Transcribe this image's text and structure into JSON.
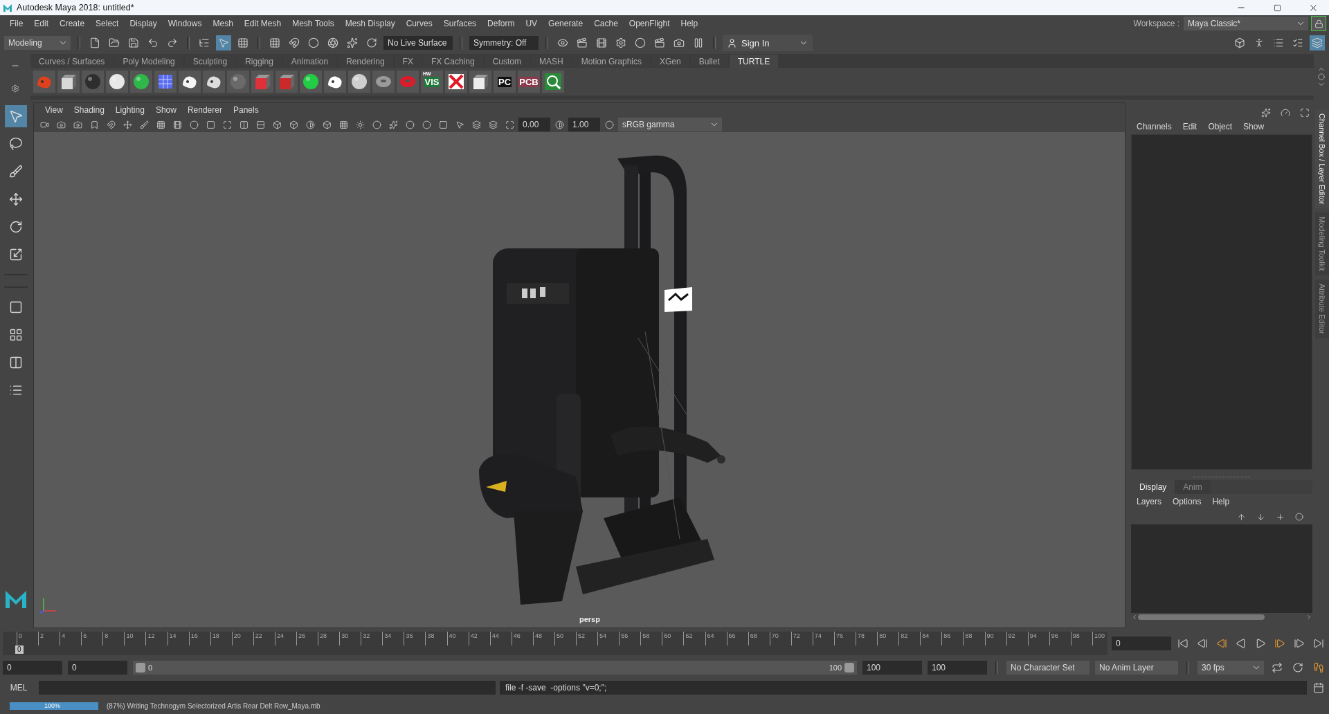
{
  "window": {
    "title": "Autodesk Maya 2018: untitled*"
  },
  "menu_bar": [
    "File",
    "Edit",
    "Create",
    "Select",
    "Display",
    "Windows",
    "Mesh",
    "Edit Mesh",
    "Mesh Tools",
    "Mesh Display",
    "Curves",
    "Surfaces",
    "Deform",
    "UV",
    "Generate",
    "Cache",
    "OpenFlight",
    "Help"
  ],
  "workspace": {
    "label": "Workspace :",
    "value": "Maya Classic*"
  },
  "status_line": {
    "menu_set": "Modeling",
    "live_surface": "No Live Surface",
    "symmetry": "Symmetry: Off",
    "sign_in": "Sign In"
  },
  "shelf_tabs": [
    {
      "label": "Curves / Surfaces",
      "selected": false
    },
    {
      "label": "Poly Modeling",
      "selected": false
    },
    {
      "label": "Sculpting",
      "selected": false
    },
    {
      "label": "Rigging",
      "selected": false
    },
    {
      "label": "Animation",
      "selected": false
    },
    {
      "label": "Rendering",
      "selected": false
    },
    {
      "label": "FX",
      "selected": false
    },
    {
      "label": "FX Caching",
      "selected": false
    },
    {
      "label": "Custom",
      "selected": false
    },
    {
      "label": "MASH",
      "selected": false
    },
    {
      "label": "Motion Graphics",
      "selected": false
    },
    {
      "label": "XGen",
      "selected": false
    },
    {
      "label": "Bullet",
      "selected": false
    },
    {
      "label": "TURTLE",
      "selected": true
    }
  ],
  "shelf_icons": [
    {
      "kind": "blob",
      "color": "#e0401c"
    },
    {
      "kind": "cube",
      "color": "#d8d8d8"
    },
    {
      "kind": "sphere",
      "color": "#2e2e2e"
    },
    {
      "kind": "sphere",
      "color": "#e8e8e8"
    },
    {
      "kind": "sphere",
      "color": "#2fb84a"
    },
    {
      "kind": "grid",
      "color": "#5a6cf0"
    },
    {
      "kind": "blob",
      "color": "#f4f4f4"
    },
    {
      "kind": "blob",
      "color": "#dddddd"
    },
    {
      "kind": "sphere",
      "color": "#6a6a6a"
    },
    {
      "kind": "cube",
      "color": "#e0303a"
    },
    {
      "kind": "cube",
      "color": "#cc2a2a"
    },
    {
      "kind": "sphere",
      "color": "#22cc44"
    },
    {
      "kind": "blob",
      "color": "#ffffff"
    },
    {
      "kind": "sphere",
      "color": "#cfcfcf"
    },
    {
      "kind": "torus",
      "color": "#9a9a9a"
    },
    {
      "kind": "torus",
      "color": "#e01a28"
    },
    {
      "kind": "label",
      "color": "#1f7a3a",
      "sublabel": "HW",
      "label": "VIS"
    },
    {
      "kind": "cross",
      "color": "#e01a28"
    },
    {
      "kind": "cube",
      "color": "#eeeeee"
    },
    {
      "kind": "label",
      "color": "#111111",
      "label": "PC"
    },
    {
      "kind": "label",
      "color": "#8a3a4a",
      "label": "PCB"
    },
    {
      "kind": "magnifier",
      "color": "#2a8a3a"
    }
  ],
  "viewport": {
    "menu": [
      "View",
      "Shading",
      "Lighting",
      "Show",
      "Renderer",
      "Panels"
    ],
    "exposure": "0.00",
    "gamma": "1.00",
    "color_space": "sRGB gamma",
    "camera": "persp"
  },
  "channel_box": {
    "menu": [
      "Channels",
      "Edit",
      "Object",
      "Show"
    ]
  },
  "layer_editor": {
    "tabs": [
      {
        "label": "Display",
        "selected": true
      },
      {
        "label": "Anim",
        "selected": false
      }
    ],
    "menu": [
      "Layers",
      "Options",
      "Help"
    ]
  },
  "side_tabs": [
    {
      "label": "Channel Box / Layer Editor",
      "selected": true
    },
    {
      "label": "Modeling Toolkit",
      "selected": false
    },
    {
      "label": "Attribute Editor",
      "selected": false
    }
  ],
  "timeline": {
    "ticks": [
      "0",
      "2",
      "4",
      "6",
      "8",
      "10",
      "12",
      "14",
      "16",
      "18",
      "20",
      "22",
      "24",
      "26",
      "28",
      "30",
      "32",
      "34",
      "36",
      "38",
      "40",
      "42",
      "44",
      "46",
      "48",
      "50",
      "52",
      "54",
      "56",
      "58",
      "60",
      "62",
      "64",
      "66",
      "68",
      "70",
      "72",
      "74",
      "76",
      "78",
      "80",
      "82",
      "84",
      "86",
      "88",
      "90",
      "92",
      "94",
      "96",
      "98",
      "100"
    ],
    "current_frame": "0",
    "level": 0,
    "frame_field": "0"
  },
  "range": {
    "start": "0",
    "inner_start": "0",
    "slider_start": "0",
    "slider_end": "100",
    "level": 1,
    "inner_end": "100",
    "end": "100",
    "character_set": "No Character Set",
    "anim_layer": "No Anim Layer",
    "fps": "30 fps"
  },
  "command_line": {
    "label": "MEL",
    "result": "file -f -save  -options \"v=0;\";"
  },
  "help_line": {
    "progress_label": "100%",
    "level": 1,
    "message": "(87%) Writing Technogym Selectorized Artis Rear Delt Row_Maya.mb"
  }
}
